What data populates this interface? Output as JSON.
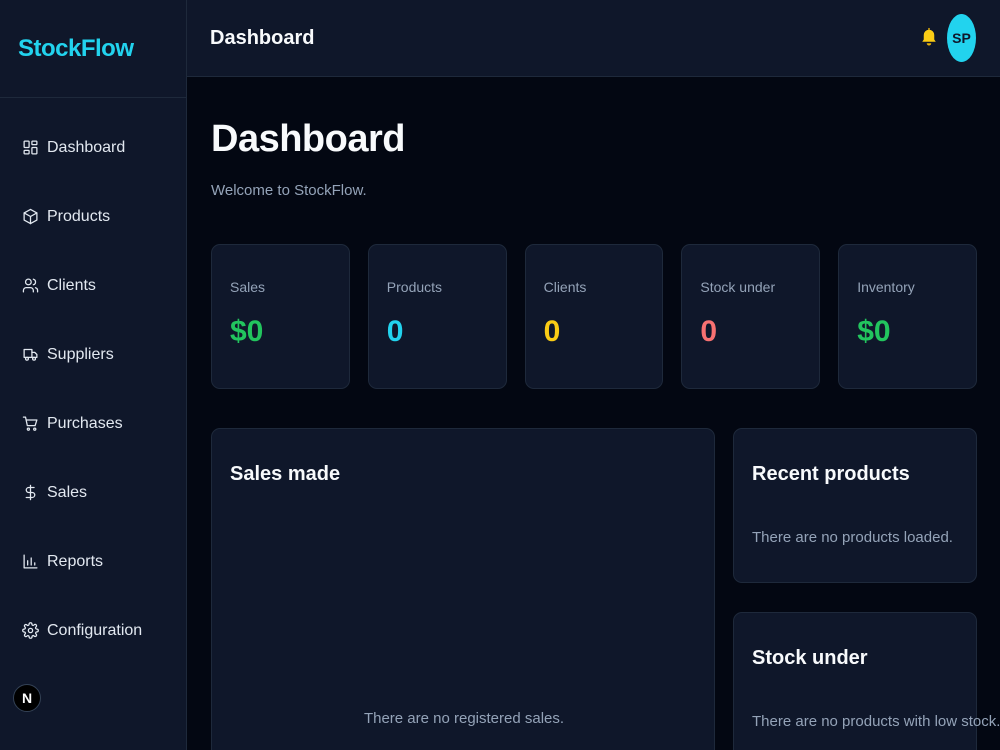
{
  "brand": "StockFlow",
  "sidebar": {
    "items": [
      {
        "label": "Dashboard",
        "icon": "dashboard-icon"
      },
      {
        "label": "Products",
        "icon": "box-icon"
      },
      {
        "label": "Clients",
        "icon": "users-icon"
      },
      {
        "label": "Suppliers",
        "icon": "truck-icon"
      },
      {
        "label": "Purchases",
        "icon": "cart-icon"
      },
      {
        "label": "Sales",
        "icon": "dollar-icon"
      },
      {
        "label": "Reports",
        "icon": "bar-chart-icon"
      },
      {
        "label": "Configuration",
        "icon": "gear-icon"
      }
    ],
    "badge": "N"
  },
  "header": {
    "title": "Dashboard",
    "avatar": "SP"
  },
  "main": {
    "title": "Dashboard",
    "subtitle": "Welcome to StockFlow.",
    "stats": [
      {
        "label": "Sales",
        "value": "$0",
        "color": "#22c55e"
      },
      {
        "label": "Products",
        "value": "0",
        "color": "#22d3ee"
      },
      {
        "label": "Clients",
        "value": "0",
        "color": "#facc15"
      },
      {
        "label": "Stock under",
        "value": "0",
        "color": "#f87171"
      },
      {
        "label": "Inventory",
        "value": "$0",
        "color": "#22c55e"
      }
    ],
    "sales_panel": {
      "title": "Sales made",
      "empty": "There are no registered sales."
    },
    "recent_panel": {
      "title": "Recent products",
      "empty": "There are no products loaded."
    },
    "stock_panel": {
      "title": "Stock under",
      "empty": "There are no products with low stock."
    }
  },
  "colors": {
    "accent": "#22d3ee",
    "background": "#030712",
    "panel": "#0f172a"
  }
}
